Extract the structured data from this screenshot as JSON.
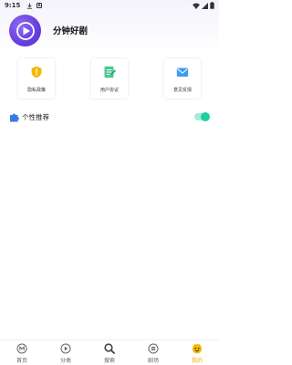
{
  "status_bar": {
    "time": "9:15",
    "badge": "A"
  },
  "header": {
    "app_name": "分钟好剧",
    "logo_icon": "play-logo-icon"
  },
  "cards": [
    {
      "label": "隐私政策",
      "icon": "shield-icon",
      "color": "#f5b800"
    },
    {
      "label": "用户协议",
      "icon": "document-icon",
      "color": "#4cc98d"
    },
    {
      "label": "意见反馈",
      "icon": "mail-icon",
      "color": "#3d9cf0"
    }
  ],
  "recommend": {
    "label": "个性推荐",
    "enabled": true,
    "icon": "puzzle-icon"
  },
  "bottom_nav": {
    "items": [
      {
        "label": "首页",
        "icon": "home-icon"
      },
      {
        "label": "分类",
        "icon": "category-icon"
      },
      {
        "label": "搜索",
        "icon": "search-icon"
      },
      {
        "label": "剧场",
        "icon": "theater-icon"
      },
      {
        "label": "我的",
        "icon": "mine-icon"
      }
    ],
    "active_index": 4,
    "active_color": "#f0a800"
  },
  "colors": {
    "accent": "#6a40e0",
    "toggle_on": "#1dcf9f"
  }
}
